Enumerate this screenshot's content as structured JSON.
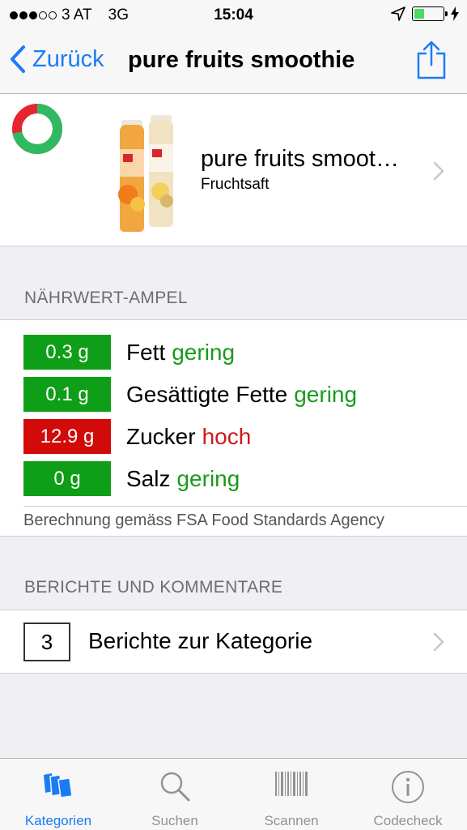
{
  "status_bar": {
    "carrier": "3 AT",
    "network": "3G",
    "time": "15:04",
    "signal_bars_on": 3,
    "battery_level": 0.35
  },
  "nav": {
    "back_label": "Zurück",
    "title": "pure fruits smoothie",
    "share_icon": "share-icon"
  },
  "product": {
    "name": "pure fruits smoot…",
    "category": "Fruchtsaft",
    "rating_green_fraction": 0.72,
    "colors": {
      "green": "#2fba62",
      "red": "#e5252f"
    }
  },
  "nutrition": {
    "header": "NÄHRWERT-AMPEL",
    "items": [
      {
        "value": "0.3 g",
        "label": "Fett",
        "level": "gering",
        "color": "#0f9e18",
        "text_color": "#1a9a1a"
      },
      {
        "value": "0.1 g",
        "label": "Gesättigte Fette",
        "level": "gering",
        "color": "#0f9e18",
        "text_color": "#1a9a1a"
      },
      {
        "value": "12.9 g",
        "label": "Zucker",
        "level": "hoch",
        "color": "#d20a0a",
        "text_color": "#cc1a1a"
      },
      {
        "value": "0 g",
        "label": "Salz",
        "level": "gering",
        "color": "#0f9e18",
        "text_color": "#1a9a1a"
      }
    ],
    "footnote": "Berechnung gemäss FSA Food Standards Agency"
  },
  "reports": {
    "header": "BERICHTE UND KOMMENTARE",
    "count": "3",
    "label": "Berichte zur Kategorie"
  },
  "tabs": [
    {
      "label": "Kategorien",
      "icon": "categories-icon",
      "active": true
    },
    {
      "label": "Suchen",
      "icon": "search-icon",
      "active": false
    },
    {
      "label": "Scannen",
      "icon": "barcode-icon",
      "active": false
    },
    {
      "label": "Codecheck",
      "icon": "info-icon",
      "active": false
    }
  ],
  "accent_color": "#1a7cf5"
}
